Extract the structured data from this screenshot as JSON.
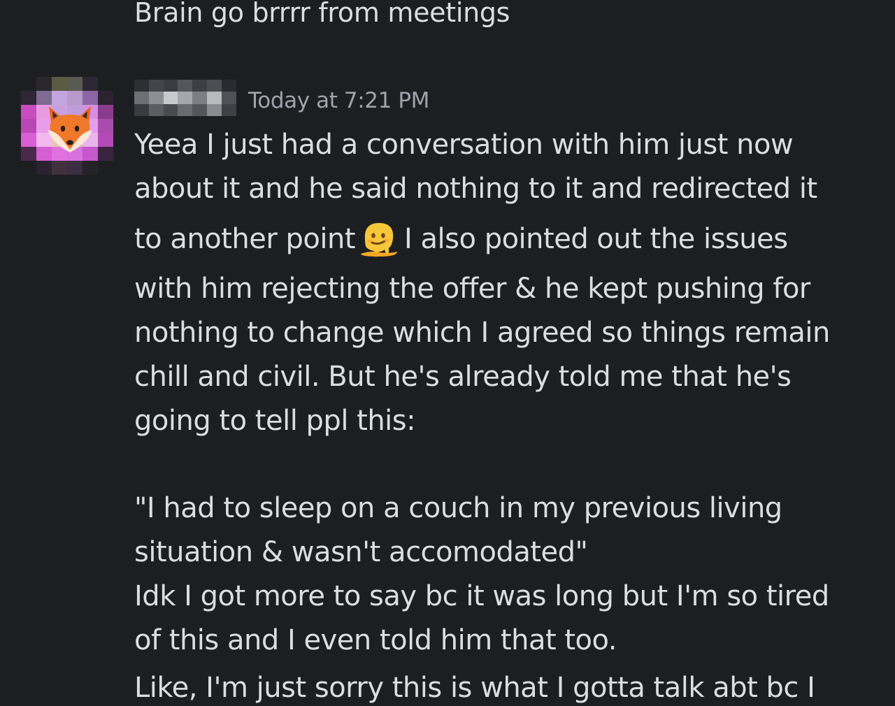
{
  "previous_message": {
    "text": "Brain go brrrr from meetings"
  },
  "message": {
    "avatar_icon": "fox-icon",
    "username_blurred": true,
    "timestamp": "Today at 7:21 PM",
    "lines": {
      "l1": "Yeea I just had a conversation with him just now",
      "l2": "about it and he said nothing to it and redirected it",
      "l3a": "to another point",
      "l3_emoji": "melting-face-icon",
      "l3b": "I also pointed out the issues",
      "l4": "with him rejecting the offer & he kept pushing for",
      "l5": "nothing to change which I agreed so things remain",
      "l6": "chill and civil. But he's already told me that he's",
      "l7": "going to tell ppl this:",
      "q1": "\"I had to sleep on a couch in my previous living",
      "q2": "situation & wasn't accomodated\"",
      "p1": "Idk I got more to say bc it was long but I'm so tired",
      "p2": "of this and I even told him that too."
    },
    "next_line_partial": "Like, I'm just sorry this is what I gotta talk abt bc I"
  },
  "colors": {
    "background": "#1d1e22",
    "text": "#dbdee1",
    "timestamp": "#a0a3ab"
  }
}
